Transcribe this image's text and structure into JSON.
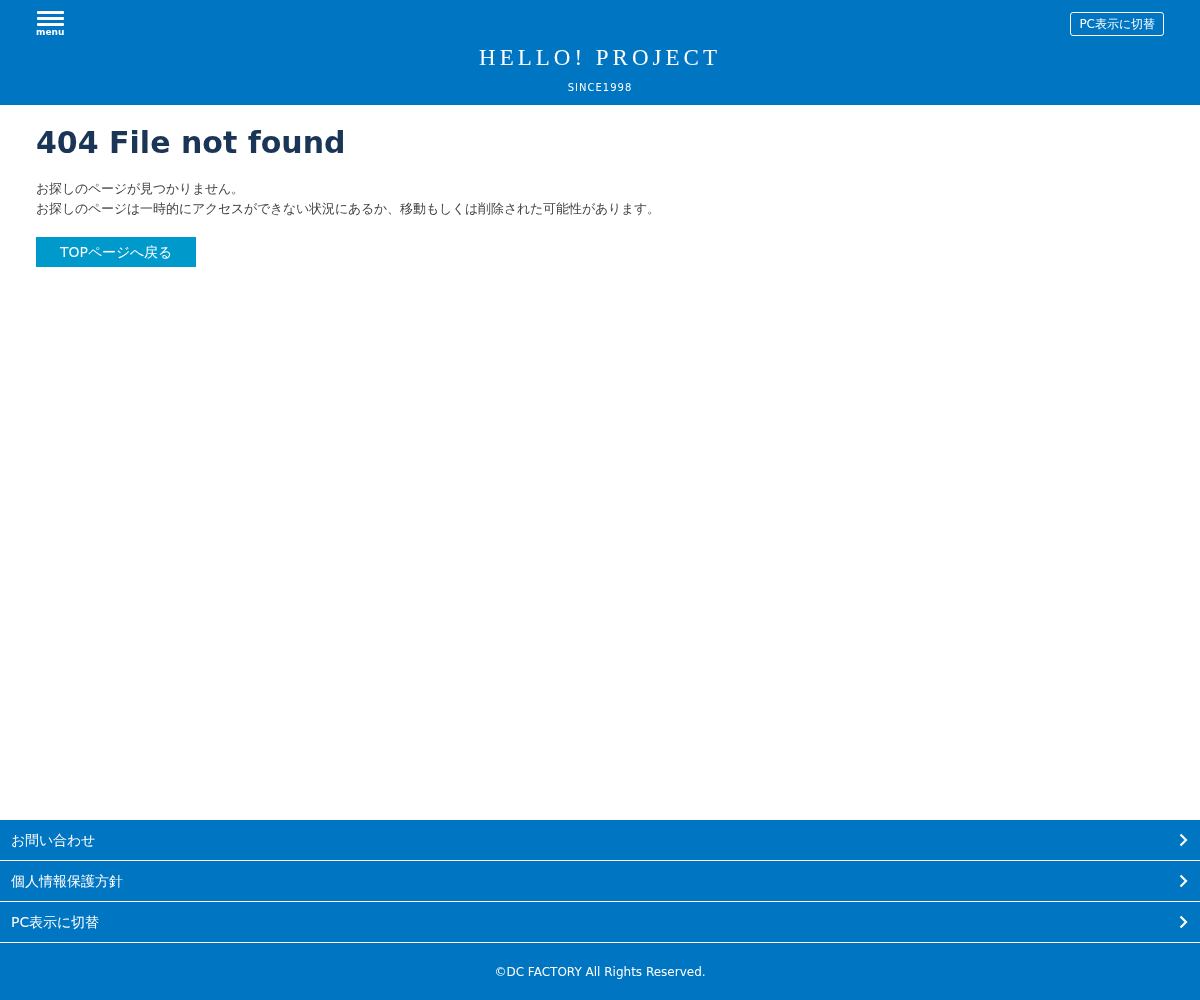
{
  "header": {
    "menu_label": "menu",
    "switch_button": "PC表示に切替",
    "logo_title": "HELLO! PROJECT",
    "logo_subtitle": "SINCE1998"
  },
  "main": {
    "heading": "404 File not found",
    "paragraphs": [
      "お探しのページが見つかりません。",
      "お探しのページは一時的にアクセスができない状況にあるか、移動もしくは削除された可能性があります。"
    ],
    "button": "TOPページへ戻る"
  },
  "footer": {
    "links": [
      "お問い合わせ",
      "個人情報保護方針",
      "PC表示に切替"
    ],
    "copyright": "©DC FACTORY All Rights Reserved."
  }
}
